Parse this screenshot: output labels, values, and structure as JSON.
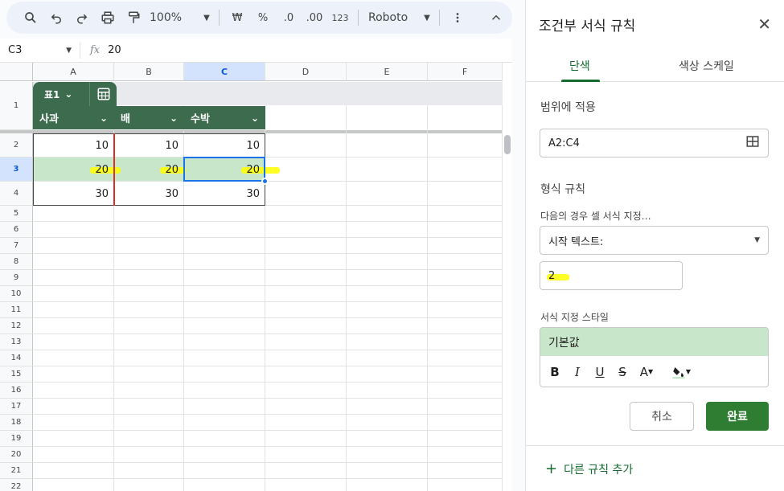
{
  "toolbar": {
    "zoom": "100%",
    "currency": "₩",
    "percent": "%",
    "decrease_decimal": ".0",
    "increase_decimal": ".00",
    "number_format": "123",
    "font": "Roboto"
  },
  "formula_bar": {
    "cell_ref": "C3",
    "fx": "fx",
    "value": "20"
  },
  "columns": [
    "A",
    "B",
    "C",
    "D",
    "E",
    "F"
  ],
  "rows": [
    "1",
    "2",
    "3",
    "4",
    "5",
    "6",
    "7",
    "8",
    "9",
    "10",
    "11",
    "12",
    "13",
    "14",
    "15",
    "16",
    "17",
    "18",
    "19",
    "20",
    "21",
    "22"
  ],
  "table": {
    "name": "표1",
    "headers": [
      "사과",
      "배",
      "수박"
    ],
    "rows": [
      [
        "10",
        "10",
        "10"
      ],
      [
        "20",
        "20",
        "20"
      ],
      [
        "30",
        "30",
        "30"
      ]
    ]
  },
  "panel": {
    "title": "조건부 서식 규칙",
    "tabs": [
      "단색",
      "색상 스케일"
    ],
    "apply_range_label": "범위에 적용",
    "range": "A2:C4",
    "format_rules_label": "형식 규칙",
    "condition_label": "다음의 경우 셀 서식 지정…",
    "condition": "시작 텍스트:",
    "value": "2",
    "style_label": "서식 지정 스타일",
    "style_preview": "기본값",
    "cancel": "취소",
    "done": "완료",
    "add_rule": "다른 규칙 추가"
  },
  "colors": {
    "table_header": "#3c6b4e",
    "highlight_fill": "#c8e6c9",
    "accent": "#146c2e",
    "done_button": "#2e7d32",
    "selection": "#1a73e8",
    "marker": "#ffff00"
  }
}
